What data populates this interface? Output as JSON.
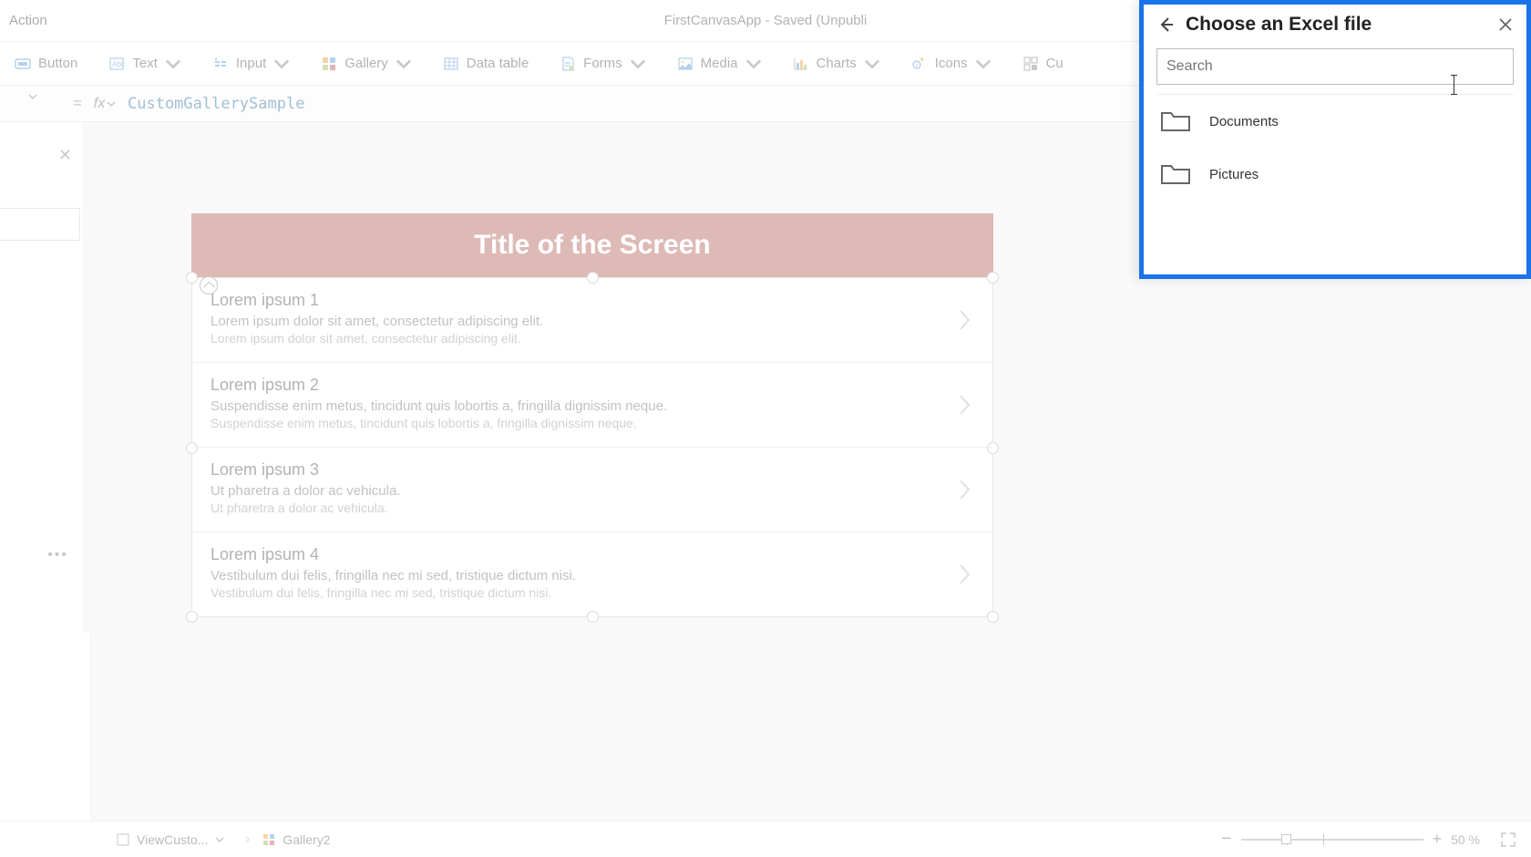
{
  "appTitle": "FirstCanvasApp - Saved (Unpubli",
  "topMenu": {
    "action": "Action"
  },
  "ribbon": {
    "button": "Button",
    "text": "Text",
    "input": "Input",
    "gallery": "Gallery",
    "dataTable": "Data table",
    "forms": "Forms",
    "media": "Media",
    "charts": "Charts",
    "icons": "Icons",
    "custom": "Cu"
  },
  "formula": {
    "eq": "=",
    "fx": "fx",
    "value": "CustomGallerySample"
  },
  "canvas": {
    "screenTitle": "Title of the Screen",
    "items": [
      {
        "t": "Lorem ipsum 1",
        "s": "Lorem ipsum dolor sit amet, consectetur adipiscing elit.",
        "d": "Lorem ipsum dolor sit amet, consectetur adipiscing elit."
      },
      {
        "t": "Lorem ipsum 2",
        "s": "Suspendisse enim metus, tincidunt quis lobortis a, fringilla dignissim neque.",
        "d": "Suspendisse enim metus, tincidunt quis lobortis a, fringilla dignissim neque."
      },
      {
        "t": "Lorem ipsum 3",
        "s": "Ut pharetra a dolor ac vehicula.",
        "d": "Ut pharetra a dolor ac vehicula."
      },
      {
        "t": "Lorem ipsum 4",
        "s": "Vestibulum dui felis, fringilla nec mi sed, tristique dictum nisi.",
        "d": "Vestibulum dui felis, fringilla nec mi sed, tristique dictum nisi."
      }
    ]
  },
  "panel": {
    "title": "Choose an Excel file",
    "searchPlaceholder": "Search",
    "folders": [
      "Documents",
      "Pictures"
    ]
  },
  "footer": {
    "crumb1": "ViewCusto...",
    "crumb2": "Gallery2",
    "zoomLabel": "50  %"
  }
}
